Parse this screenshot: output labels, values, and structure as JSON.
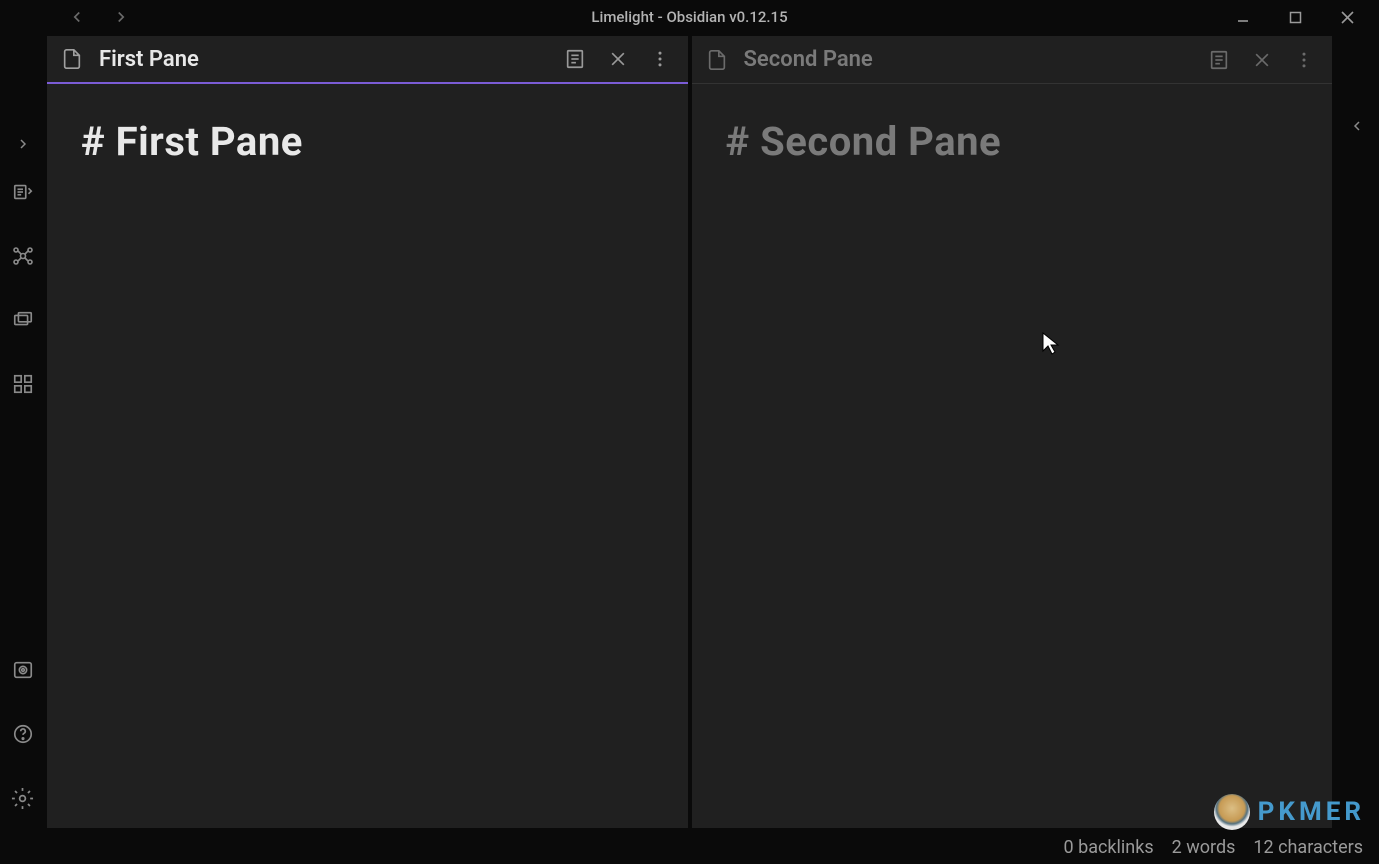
{
  "titlebar": {
    "title": "Limelight - Obsidian v0.12.15"
  },
  "panes": [
    {
      "title": "First Pane",
      "heading": "# First Pane",
      "active": true
    },
    {
      "title": "Second Pane",
      "heading": "# Second Pane",
      "active": false
    }
  ],
  "statusbar": {
    "backlinks": "0 backlinks",
    "words": "2 words",
    "characters": "12 characters"
  },
  "watermark": "PKMER"
}
